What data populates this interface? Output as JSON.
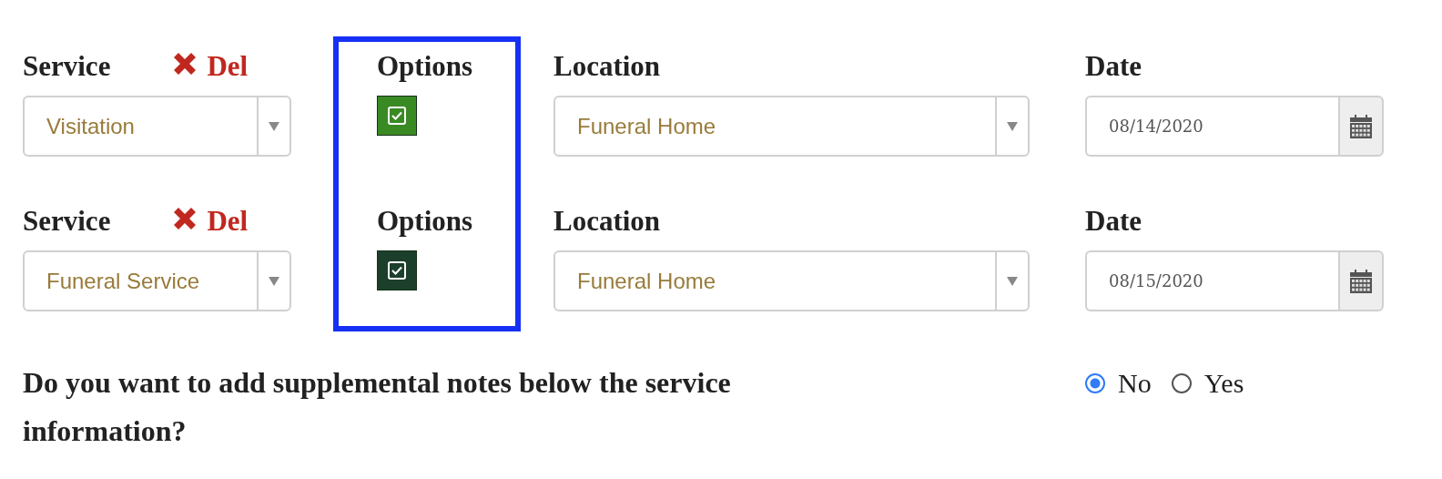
{
  "services": [
    {
      "service_label": "Service",
      "delete_label": "Del",
      "service": "Visitation",
      "options_label": "Options",
      "options_checked": true,
      "color": "#3a8a24",
      "location_label": "Location",
      "location": "Funeral Home",
      "date_label": "Date",
      "date": "08/14/2020"
    },
    {
      "service_label": "Service",
      "delete_label": "Del",
      "service": "Funeral Service",
      "options_label": "Options",
      "options_checked": true,
      "color": "#1b3f2a",
      "location_label": "Location",
      "location": "Funeral Home",
      "date_label": "Date",
      "date": "08/15/2020"
    }
  ],
  "notes_question": {
    "text": "Do you want to add supplemental notes below the service information?",
    "options": [
      {
        "label": "No",
        "selected": true
      },
      {
        "label": "Yes",
        "selected": false
      }
    ]
  }
}
